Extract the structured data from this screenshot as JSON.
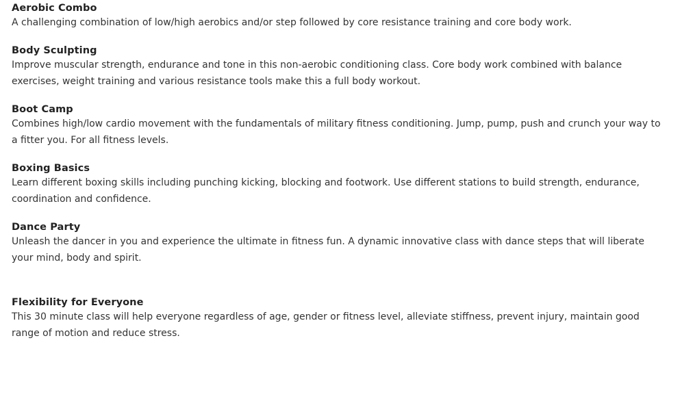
{
  "classes": [
    {
      "title": "Aerobic Combo",
      "description": "A challenging combination of low/high aerobics and/or step followed by core resistance training and core body work."
    },
    {
      "title": "Body Sculpting",
      "description": "Improve muscular strength, endurance and tone in this non-aerobic conditioning class. Core body work combined with balance exercises, weight training and various resistance tools make this a full body workout."
    },
    {
      "title": "Boot Camp",
      "description": "Combines high/low cardio movement with the fundamentals of military fitness conditioning. Jump, pump, push and crunch your way to a fitter you. For all fitness levels."
    },
    {
      "title": "Boxing Basics",
      "description": "Learn different boxing skills including punching kicking, blocking and footwork. Use different stations to build strength, endurance, coordination and confidence."
    },
    {
      "title": "Dance Party",
      "description": "Unleash the dancer in you and experience the ultimate in fitness fun. A dynamic innovative class with dance steps that will liberate your mind, body and spirit."
    },
    {
      "title": "Flexibility for Everyone",
      "description": "This 30 minute class will help everyone regardless of age, gender or fitness level, alleviate stiffness, prevent injury, maintain good range of motion and reduce stress."
    }
  ]
}
